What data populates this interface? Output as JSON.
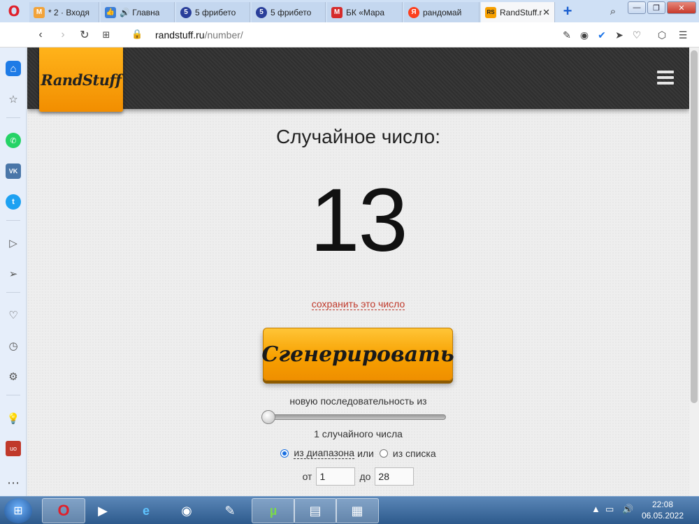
{
  "browser": {
    "tabs": [
      {
        "label": "* 2 · Входя",
        "favicon_color": "#f2a33a",
        "favicon_glyph": "M"
      },
      {
        "label": "🔊 Главна",
        "favicon_color": "#3b7fd9",
        "favicon_glyph": "👍"
      },
      {
        "label": "5 фрибето",
        "favicon_color": "#2a3f9a",
        "favicon_glyph": "5"
      },
      {
        "label": "5 фрибето",
        "favicon_color": "#2a3f9a",
        "favicon_glyph": "5"
      },
      {
        "label": "БК «Мара",
        "favicon_color": "#d52b2b",
        "favicon_glyph": "M"
      },
      {
        "label": "рандомай",
        "favicon_color": "#fc3f1d",
        "favicon_glyph": "Я"
      },
      {
        "label": "RandStuff.r",
        "favicon_color": "#f7a000",
        "favicon_glyph": "RS"
      }
    ],
    "new_tab_label": "+",
    "url_host": "randstuff.ru",
    "url_path": "/number/"
  },
  "site": {
    "logo_text": "RandStuff"
  },
  "main": {
    "title": "Случайное число:",
    "number": "13",
    "save_link": "сохранить это число",
    "generate_button": "Сгенерировать",
    "sequence_text": "новую последовательность из",
    "slider_value": 1,
    "count_text": "1 случайного числа",
    "mode_range_label": "из диапазона",
    "mode_or": "или",
    "mode_list_label": "из списка",
    "selected_mode": "range",
    "from_label": "от",
    "from_value": "1",
    "to_label": "до",
    "to_value": "28"
  },
  "taskbar": {
    "time": "22:08",
    "date": "06.05.2022"
  },
  "colors": {
    "accent_orange": "#f7a000",
    "link_red": "#c0392b",
    "opera_red": "#e0202b"
  }
}
